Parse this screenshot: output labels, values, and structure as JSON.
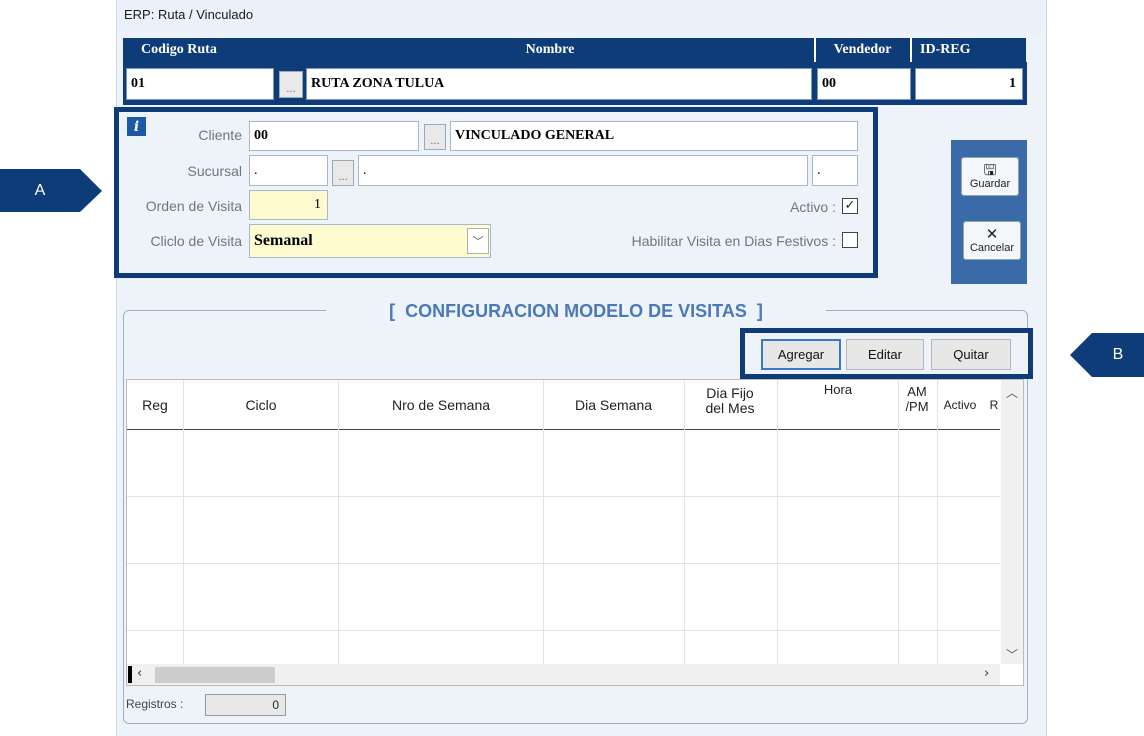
{
  "window": {
    "title": "ERP: Ruta / Vinculado"
  },
  "route_header": {
    "col_code": "Codigo Ruta",
    "col_name": "Nombre",
    "col_seller": "Vendedor",
    "col_id": "ID-REG",
    "code_value": "01",
    "code_lookup": "...",
    "name_value": "RUTA ZONA TULUA",
    "seller_value": "00",
    "id_value": "1"
  },
  "client_panel": {
    "info_icon": "info-icon",
    "cliente_label": "Cliente",
    "cliente_code": "00",
    "cliente_lookup": "...",
    "cliente_name": "VINCULADO GENERAL",
    "sucursal_label": "Sucursal",
    "sucursal_code": ".",
    "sucursal_lookup": "...",
    "sucursal_name": ".",
    "sucursal_extra": ".",
    "orden_label": "Orden de Visita",
    "orden_value": "1",
    "activo_label": "Activo :",
    "activo_checked": true,
    "ciclo_label": "Cliclo de Visita",
    "ciclo_value": "Semanal",
    "festivos_label": "Habilitar Visita en Dias Festivos :",
    "festivos_checked": false
  },
  "actions": {
    "save_label": "Guardar",
    "cancel_label": "Cancelar"
  },
  "visits": {
    "section_title": "[  CONFIGURACION MODELO DE VISITAS  ]",
    "add_label": "Agregar",
    "edit_label": "Editar",
    "remove_label": "Quitar",
    "columns": {
      "reg": "Reg",
      "ciclo": "Ciclo",
      "nro_semana": "Nro de Semana",
      "dia_semana": "Dia Semana",
      "dia_fijo_1": "Dia Fijo",
      "dia_fijo_2": "del Mes",
      "hora": "Hora",
      "ampm_1": "AM",
      "ampm_2": "/PM",
      "activo": "Activo",
      "extra": "R"
    },
    "registros_label": "Registros :",
    "registros_value": "0"
  },
  "callouts": {
    "a": "A",
    "b": "B"
  },
  "colors": {
    "navy": "#0e3c78",
    "panel_blue": "#3b6aa8",
    "yellow_input": "#fffbd0"
  }
}
